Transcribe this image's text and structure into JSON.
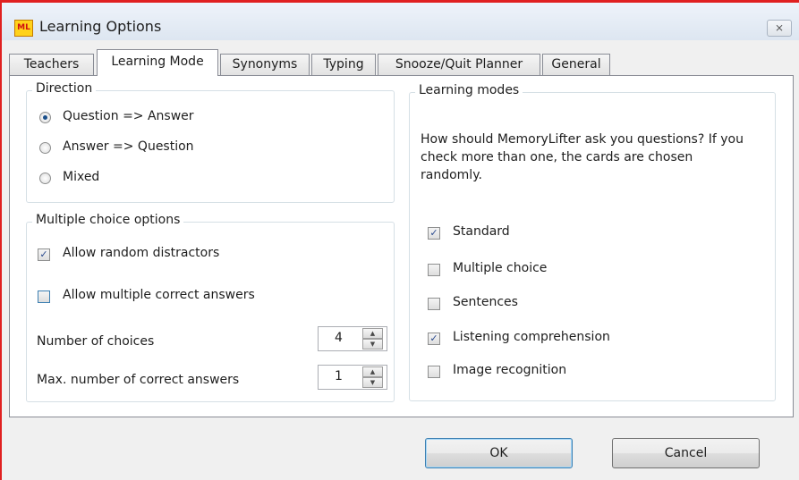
{
  "window": {
    "title": "Learning Options",
    "icon_text": "ML",
    "close_glyph": "⨯"
  },
  "tabs": [
    {
      "label": "Teachers",
      "active": false
    },
    {
      "label": "Learning Mode",
      "active": true
    },
    {
      "label": "Synonyms",
      "active": false
    },
    {
      "label": "Typing",
      "active": false
    },
    {
      "label": "Snooze/Quit Planner",
      "active": false
    },
    {
      "label": "General",
      "active": false
    }
  ],
  "direction": {
    "legend": "Direction",
    "options": [
      {
        "label": "Question => Answer",
        "selected": true
      },
      {
        "label": "Answer => Question",
        "selected": false
      },
      {
        "label": "Mixed",
        "selected": false
      }
    ]
  },
  "multiple_choice": {
    "legend": "Multiple choice options",
    "allow_random_distractors": {
      "label": "Allow random distractors",
      "checked": true
    },
    "allow_multiple_correct": {
      "label": "Allow multiple correct answers",
      "checked": false
    },
    "number_of_choices": {
      "label": "Number of choices",
      "value": "4"
    },
    "max_correct": {
      "label": "Max. number of correct answers",
      "value": "1"
    }
  },
  "learning_modes": {
    "legend": "Learning modes",
    "description": "How should MemoryLifter ask you questions? If you check more than one, the cards are chosen randomly.",
    "modes": [
      {
        "label": "Standard",
        "checked": true
      },
      {
        "label": "Multiple choice",
        "checked": false
      },
      {
        "label": "Sentences",
        "checked": false
      },
      {
        "label": "Listening comprehension",
        "checked": true
      },
      {
        "label": "Image recognition",
        "checked": false
      }
    ]
  },
  "buttons": {
    "ok": "OK",
    "cancel": "Cancel"
  },
  "icons": {
    "check_glyph": "✓",
    "spin_up": "▲",
    "spin_down": "▼"
  },
  "colors": {
    "window_border": "#e02020",
    "radio_dot": "#1a4f8a",
    "default_button_border": "#3c7fb1"
  }
}
